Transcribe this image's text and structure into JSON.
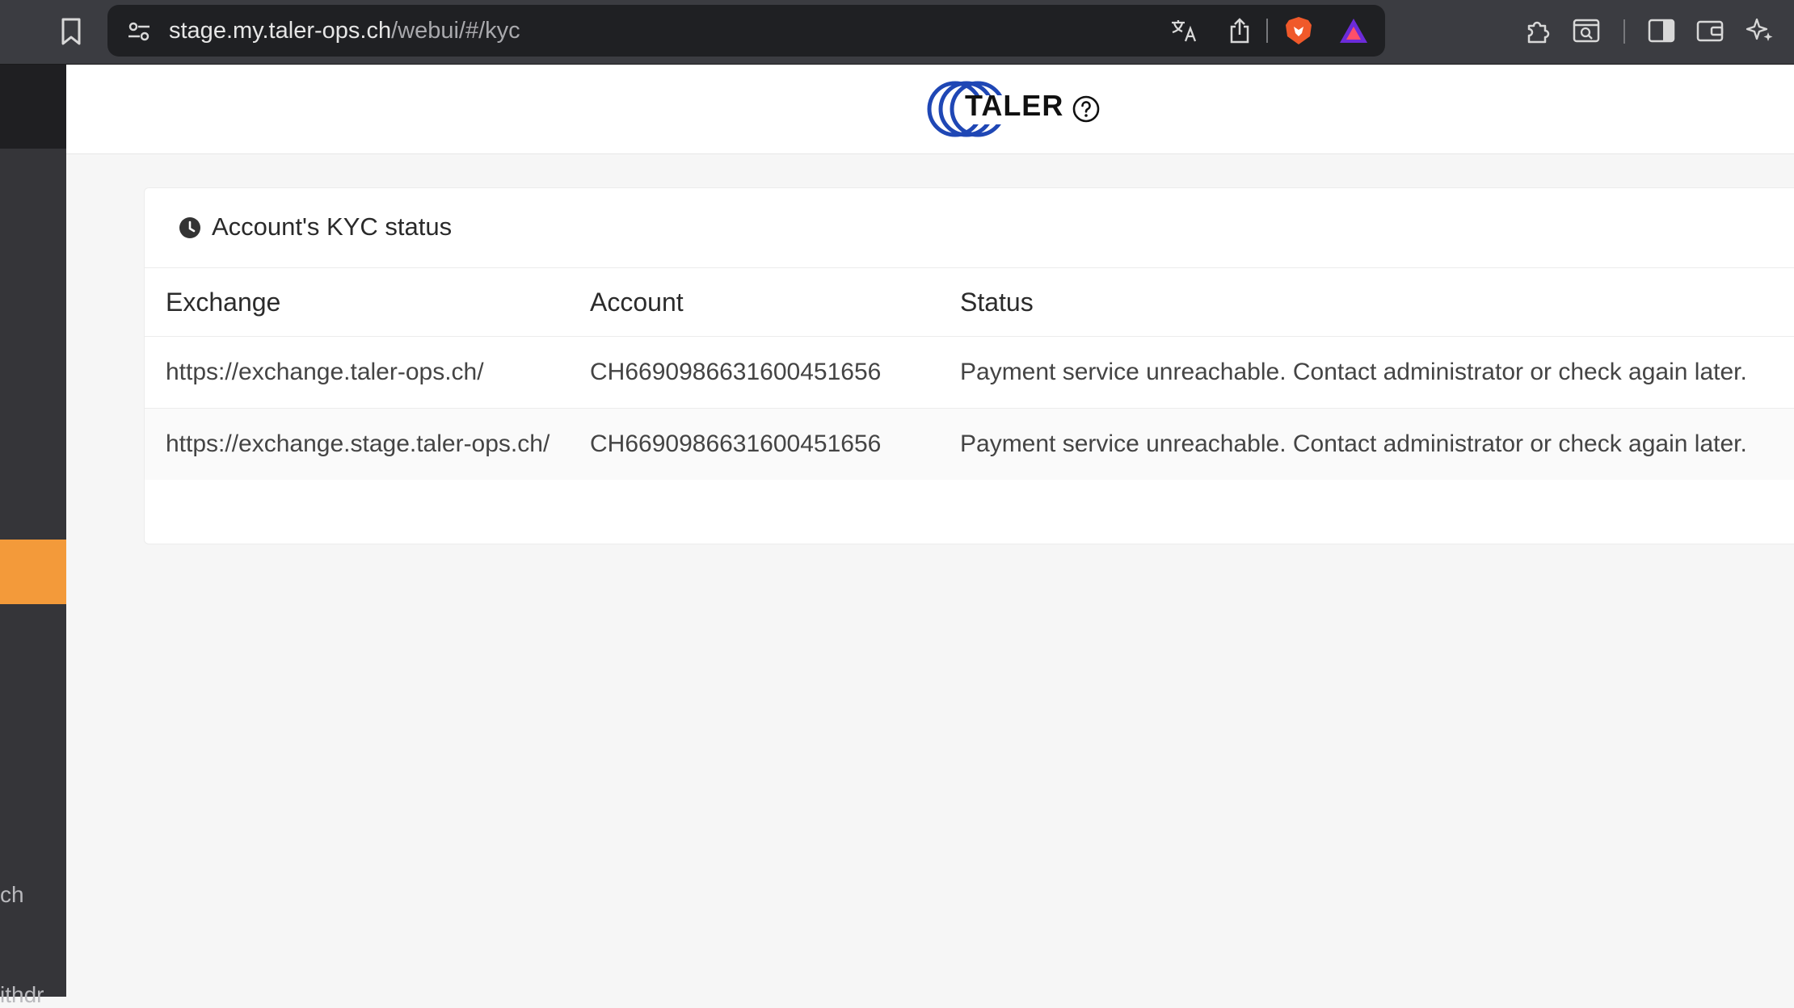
{
  "browser": {
    "url_host": "stage.my.taler-ops.ch",
    "url_path": "/webui/#/kyc"
  },
  "sidebar": {
    "partial_labels": [
      "ch",
      "ithdr"
    ]
  },
  "header": {
    "logo_text": "TALER"
  },
  "kyc": {
    "title": "Account's KYC status",
    "columns": [
      "Exchange",
      "Account",
      "Status"
    ],
    "rows": [
      {
        "exchange": "https://exchange.taler-ops.ch/",
        "account": "CH6690986631600451656",
        "status": "Payment service unreachable. Contact administrator or check again later."
      },
      {
        "exchange": "https://exchange.stage.taler-ops.ch/",
        "account": "CH6690986631600451656",
        "status": "Payment service unreachable. Contact administrator or check again later."
      }
    ]
  },
  "colors": {
    "accent": "#f39a3a",
    "logo_blue": "#1f47b5"
  }
}
